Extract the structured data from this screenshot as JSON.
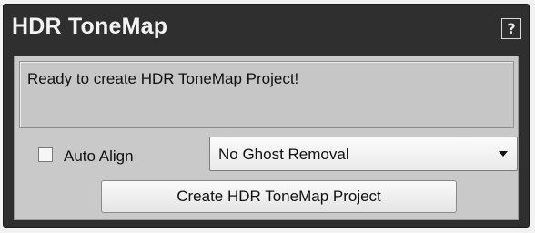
{
  "panel": {
    "title": "HDR ToneMap",
    "help_label": "?"
  },
  "status": {
    "message": "Ready to create HDR ToneMap Project!"
  },
  "options": {
    "auto_align_label": "Auto Align",
    "auto_align_checked": false,
    "ghost_removal_selected": "No Ghost Removal"
  },
  "actions": {
    "create_label": "Create HDR ToneMap Project"
  },
  "icons": {
    "help": "help-icon",
    "dropdown": "chevron-down-icon"
  },
  "colors": {
    "panel_bg": "#2f2f2f",
    "content_bg": "#c9c9c9",
    "title_text": "#f2f2f2"
  }
}
